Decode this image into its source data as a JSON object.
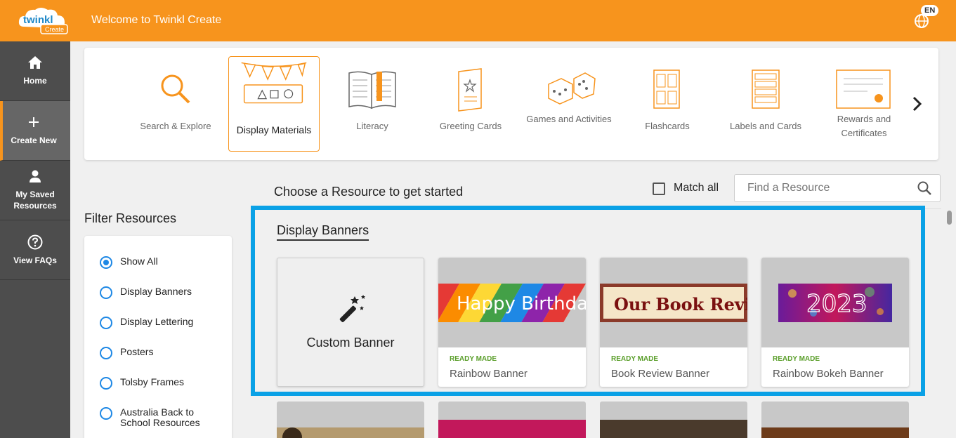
{
  "header": {
    "title": "Welcome to Twinkl Create",
    "logo_text": "twinkl",
    "logo_badge": "Create",
    "language": "EN",
    "brand_color": "#f7941d"
  },
  "sidebar": {
    "items": [
      {
        "label": "Home",
        "icon": "home-icon"
      },
      {
        "label": "Create New",
        "icon": "plus-icon",
        "active": true
      },
      {
        "label": "My Saved Resources",
        "icon": "person-icon"
      },
      {
        "label": "View FAQs",
        "icon": "question-icon"
      }
    ]
  },
  "categories": [
    {
      "label": "Search & Explore",
      "icon": "magnifier-icon"
    },
    {
      "label": "Display Materials",
      "icon": "bunting-icon",
      "active": true
    },
    {
      "label": "Literacy",
      "icon": "book-icon"
    },
    {
      "label": "Greeting Cards",
      "icon": "card-icon"
    },
    {
      "label": "Games and Activities",
      "icon": "dice-icon"
    },
    {
      "label": "Flashcards",
      "icon": "flashcard-icon"
    },
    {
      "label": "Labels and Cards",
      "icon": "labels-icon"
    },
    {
      "label": "Rewards and Certificates",
      "icon": "certificate-icon"
    }
  ],
  "main": {
    "title": "Choose a Resource to get started",
    "match_all_label": "Match all",
    "search_placeholder": "Find a Resource"
  },
  "filter": {
    "title": "Filter Resources",
    "options": [
      {
        "label": "Show All",
        "selected": true
      },
      {
        "label": "Display Banners",
        "selected": false
      },
      {
        "label": "Display Lettering",
        "selected": false
      },
      {
        "label": "Posters",
        "selected": false
      },
      {
        "label": "Tolsby Frames",
        "selected": false
      },
      {
        "label": "Australia Back to School Resources",
        "selected": false
      }
    ]
  },
  "section": {
    "title": "Display Banners",
    "custom_label": "Custom Banner",
    "tiles": [
      {
        "tag": "READY MADE",
        "name": "Rainbow Banner",
        "banner_text": "Happy Birthday"
      },
      {
        "tag": "READY MADE",
        "name": "Book Review Banner",
        "banner_text": "Our Book Review"
      },
      {
        "tag": "READY MADE",
        "name": "Rainbow Bokeh Banner",
        "banner_text": "2023"
      }
    ],
    "highlight_color": "#0aa1e6"
  }
}
